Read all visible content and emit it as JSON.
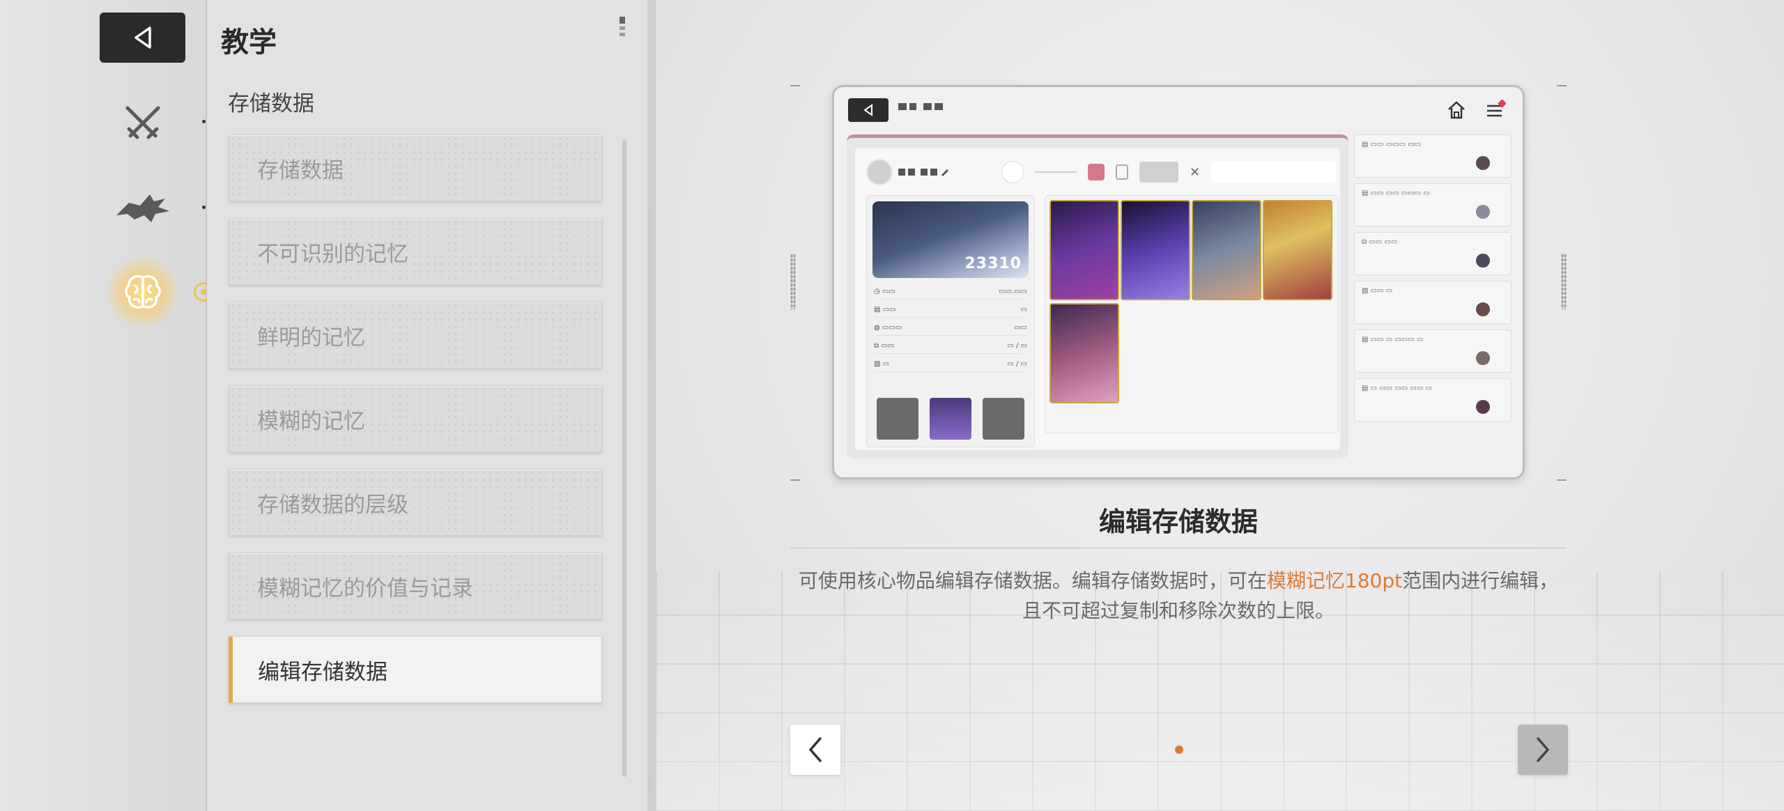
{
  "header": {
    "title": "教学"
  },
  "section": {
    "label": "存储数据"
  },
  "menu": {
    "items": [
      {
        "label": "存储数据",
        "active": false
      },
      {
        "label": "不可识别的记忆",
        "active": false
      },
      {
        "label": "鲜明的记忆",
        "active": false
      },
      {
        "label": "模糊的记忆",
        "active": false
      },
      {
        "label": "存储数据的层级",
        "active": false
      },
      {
        "label": "模糊记忆的价值与记录",
        "active": false
      },
      {
        "label": "编辑存储数据",
        "active": true
      }
    ]
  },
  "rail": {
    "icons": [
      "crossed-swords-icon",
      "beast-icon",
      "brain-icon"
    ],
    "selected": "brain-icon",
    "accent": "#f0c040"
  },
  "preview": {
    "score": "23310"
  },
  "content": {
    "title": "编辑存储数据",
    "body_prefix": "可使用核心物品编辑存储数据。编辑存储数据时，可在",
    "body_highlight": "模糊记忆180pt",
    "body_suffix": "范围内进行编辑，且不可超过复制和移除次数的上限。",
    "highlight_color": "#e07a2e"
  },
  "pagination": {
    "current": 1,
    "total": 1,
    "dot_color": "#e07a2e"
  }
}
